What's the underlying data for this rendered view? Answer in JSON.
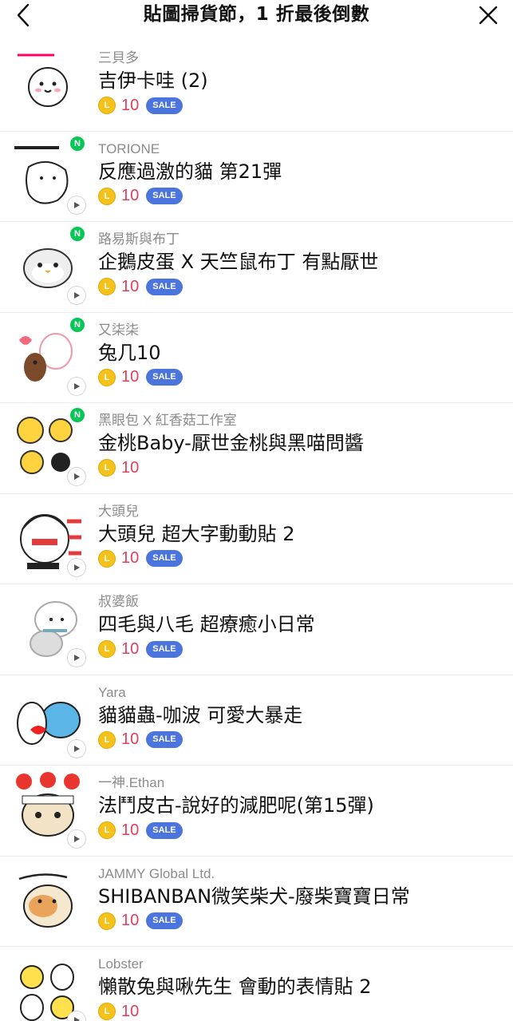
{
  "header": {
    "title": "貼圖掃貨節，1 折最後倒數"
  },
  "colors": {
    "price": "#e03f5b",
    "sale_badge": "#4b74dd",
    "coin": "#f4c21a",
    "new_badge": "#06c755"
  },
  "items": [
    {
      "author": "三貝多",
      "title": "吉伊卡哇 (2)",
      "price": "10",
      "sale": "SALE",
      "coin_letter": "L",
      "icon": "sticker-thumbnail"
    },
    {
      "author": "TORIONE",
      "title": "反應過激的貓 第21彈",
      "price": "10",
      "sale": "SALE",
      "coin_letter": "L",
      "new": "N",
      "icon": "sticker-thumbnail"
    },
    {
      "author": "路易斯與布丁",
      "title": "企鵝皮蛋 X 天竺鼠布丁 有點厭世",
      "price": "10",
      "sale": "SALE",
      "coin_letter": "L",
      "new": "N",
      "icon": "sticker-thumbnail"
    },
    {
      "author": "又柒柒",
      "title": "兔几10",
      "price": "10",
      "sale": "SALE",
      "coin_letter": "L",
      "new": "N",
      "icon": "sticker-thumbnail"
    },
    {
      "author": "黑眼包 X 紅香菇工作室",
      "title": "金桃Baby-厭世金桃與黑喵問醬",
      "price": "10",
      "sale": "",
      "coin_letter": "L",
      "new": "N",
      "icon": "sticker-thumbnail"
    },
    {
      "author": "大頭兒",
      "title": "大頭兒 超大字動動貼 2",
      "price": "10",
      "sale": "SALE",
      "coin_letter": "L",
      "icon": "sticker-thumbnail"
    },
    {
      "author": "叔婆飯",
      "title": "四毛與八毛 超療癒小日常",
      "price": "10",
      "sale": "SALE",
      "coin_letter": "L",
      "icon": "sticker-thumbnail"
    },
    {
      "author": "Yara",
      "title": "貓貓蟲-咖波 可愛大暴走",
      "price": "10",
      "sale": "SALE",
      "coin_letter": "L",
      "icon": "sticker-thumbnail"
    },
    {
      "author": "一神.Ethan",
      "title": "法鬥皮古-說好的減肥呢(第15彈)",
      "price": "10",
      "sale": "SALE",
      "coin_letter": "L",
      "icon": "sticker-thumbnail"
    },
    {
      "author": "JAMMY Global Ltd.",
      "title": "SHIBANBAN微笑柴犬-廢柴寶寶日常",
      "price": "10",
      "sale": "SALE",
      "coin_letter": "L",
      "icon": "sticker-thumbnail"
    },
    {
      "author": "Lobster",
      "title": "懶散兔與啾先生 會動的表情貼 2",
      "price": "10",
      "sale": "",
      "coin_letter": "L",
      "icon": "sticker-thumbnail"
    }
  ]
}
